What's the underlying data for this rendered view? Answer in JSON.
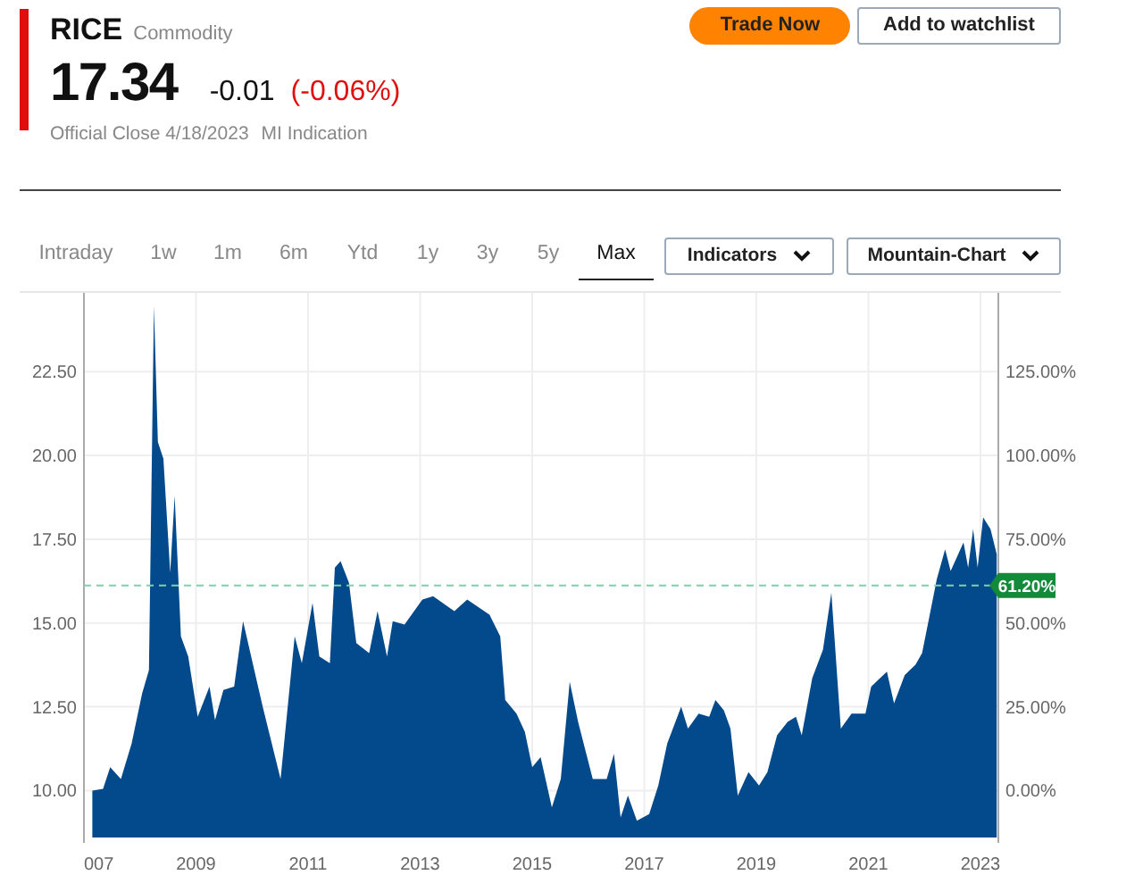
{
  "quote": {
    "symbol": "RICE",
    "type": "Commodity",
    "price": "17.34",
    "change": "-0.01",
    "change_percent": "(-0.06%)",
    "close_note": "Official Close 4/18/2023",
    "indication": "MI Indication"
  },
  "buttons": [
    {
      "label": "Trade Now",
      "kind": "primary"
    },
    {
      "label": "Add to watchlist",
      "kind": "outline"
    }
  ],
  "ranges": [
    {
      "label": "Intraday",
      "selected": false
    },
    {
      "label": "1w",
      "selected": false
    },
    {
      "label": "1m",
      "selected": false
    },
    {
      "label": "6m",
      "selected": false
    },
    {
      "label": "Ytd",
      "selected": false
    },
    {
      "label": "1y",
      "selected": false
    },
    {
      "label": "3y",
      "selected": false
    },
    {
      "label": "5y",
      "selected": false
    },
    {
      "label": "Max",
      "selected": true
    }
  ],
  "dropdowns": [
    {
      "label": "Indicators"
    },
    {
      "label": "Mountain-Chart"
    }
  ],
  "chart": {
    "chart_data": {
      "type": "area",
      "x": [
        2007.15,
        2007.34,
        2007.47,
        2007.66,
        2007.85,
        2008.04,
        2008.16,
        2008.25,
        2008.32,
        2008.42,
        2008.54,
        2008.62,
        2008.73,
        2008.86,
        2009.03,
        2009.24,
        2009.34,
        2009.49,
        2009.68,
        2009.84,
        2010.19,
        2010.51,
        2010.76,
        2010.89,
        2011.08,
        2011.2,
        2011.39,
        2011.48,
        2011.58,
        2011.73,
        2011.86,
        2012.09,
        2012.24,
        2012.41,
        2012.51,
        2012.72,
        2013.04,
        2013.23,
        2013.61,
        2013.84,
        2014.24,
        2014.43,
        2014.52,
        2014.72,
        2014.87,
        2015.0,
        2015.15,
        2015.35,
        2015.51,
        2015.67,
        2015.82,
        2016.08,
        2016.33,
        2016.46,
        2016.58,
        2016.71,
        2016.87,
        2017.09,
        2017.25,
        2017.41,
        2017.66,
        2017.78,
        2017.97,
        2018.16,
        2018.27,
        2018.42,
        2018.54,
        2018.67,
        2018.86,
        2019.05,
        2019.2,
        2019.37,
        2019.56,
        2019.71,
        2019.81,
        2020.0,
        2020.19,
        2020.34,
        2020.51,
        2020.7,
        2020.95,
        2021.05,
        2021.33,
        2021.46,
        2021.65,
        2021.84,
        2021.96,
        2022.06,
        2022.22,
        2022.37,
        2022.47,
        2022.7,
        2022.78,
        2022.87,
        2022.95,
        2023.05,
        2023.18,
        2023.29
      ],
      "series": [
        {
          "color": "#034a8c",
          "values": [
            10.0,
            10.05,
            10.7,
            10.35,
            11.4,
            12.9,
            13.6,
            24.45,
            20.4,
            19.9,
            16.5,
            18.8,
            14.6,
            14.0,
            12.2,
            13.1,
            12.1,
            13.0,
            13.1,
            15.05,
            12.5,
            10.35,
            14.6,
            13.8,
            15.6,
            14.0,
            13.8,
            16.65,
            16.85,
            16.2,
            14.4,
            14.1,
            15.35,
            14.0,
            15.05,
            14.95,
            15.7,
            15.8,
            15.35,
            15.7,
            15.25,
            14.6,
            12.7,
            12.3,
            11.75,
            10.7,
            11.0,
            9.5,
            10.35,
            13.25,
            12.05,
            10.35,
            10.35,
            11.1,
            9.2,
            9.85,
            9.1,
            9.3,
            10.15,
            11.4,
            12.5,
            11.85,
            12.3,
            12.2,
            12.7,
            12.4,
            11.85,
            9.85,
            10.55,
            10.15,
            10.55,
            11.65,
            12.05,
            12.2,
            11.65,
            13.35,
            14.2,
            15.9,
            11.85,
            12.3,
            12.3,
            13.1,
            13.55,
            12.6,
            13.45,
            13.75,
            14.1,
            14.95,
            16.3,
            17.2,
            16.55,
            17.4,
            16.65,
            17.8,
            16.65,
            18.15,
            17.8,
            17.05
          ]
        }
      ],
      "xlim": [
        2007,
        2023.32
      ],
      "ylim": [
        8.6,
        24.85
      ],
      "xticks": [
        {
          "value": 2009,
          "label": "2009"
        },
        {
          "value": 2011,
          "label": "2011"
        },
        {
          "value": 2013,
          "label": "2013"
        },
        {
          "value": 2015,
          "label": "2015"
        },
        {
          "value": 2017,
          "label": "2017"
        },
        {
          "value": 2019,
          "label": "2019"
        },
        {
          "value": 2021,
          "label": "2021"
        },
        {
          "value": 2023,
          "label": "2023"
        }
      ],
      "yticks": [
        {
          "value": 10,
          "label": "10.00"
        },
        {
          "value": 12.5,
          "label": "12.50"
        },
        {
          "value": 15,
          "label": "15.00"
        },
        {
          "value": 17.5,
          "label": "17.50"
        },
        {
          "value": 20,
          "label": "20.00"
        },
        {
          "value": 22.5,
          "label": "22.50"
        }
      ],
      "y2lim": [
        -14,
        148.5
      ],
      "y2ticks": [
        {
          "value": 0,
          "label": "0.00%"
        },
        {
          "value": 25,
          "label": "25.00%"
        },
        {
          "value": 50,
          "label": "50.00%"
        },
        {
          "value": 75,
          "label": "75.00%"
        },
        {
          "value": 100,
          "label": "100.00%"
        },
        {
          "value": 125,
          "label": "125.00%"
        }
      ],
      "grid": true,
      "ref_lines": [
        {
          "value": 61.2,
          "label": "61.20%",
          "axis": "y2"
        }
      ]
    },
    "x_edge_label": "007"
  }
}
